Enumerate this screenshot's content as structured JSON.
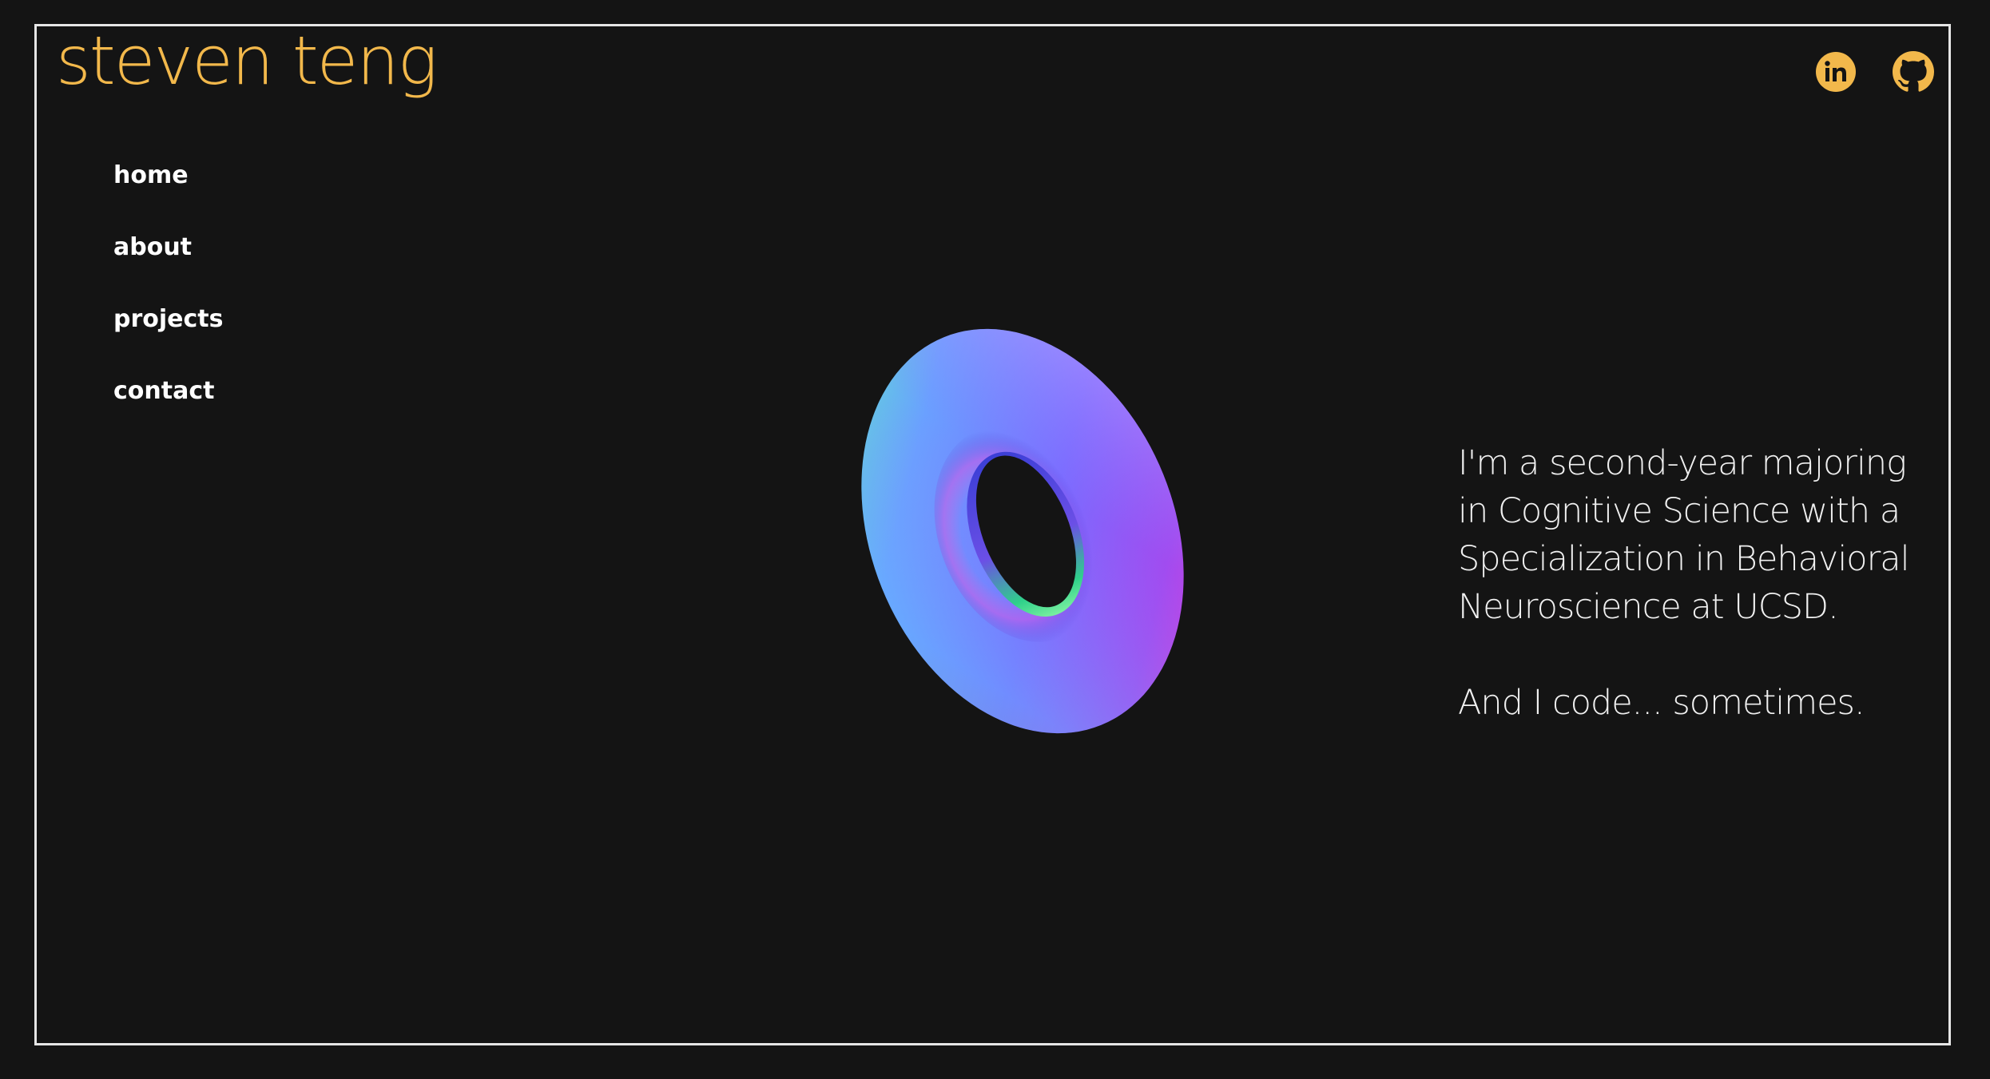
{
  "header": {
    "logo_text": "steven teng",
    "accent_color": "#f2b84b",
    "social": [
      {
        "name": "linkedin",
        "icon": "linkedin-icon"
      },
      {
        "name": "github",
        "icon": "github-icon"
      }
    ]
  },
  "nav": {
    "items": [
      {
        "label": "home"
      },
      {
        "label": "about"
      },
      {
        "label": "projects"
      },
      {
        "label": "contact"
      }
    ]
  },
  "hero": {
    "graphic": "rainbow-torus",
    "intro_line1": "I'm a second-year majoring in Cognitive Science with a Specialization in Behavioral Neuroscience at UCSD.",
    "intro_line2": "And I code... sometimes."
  },
  "theme": {
    "background": "#141414",
    "frame_border": "#e6e6e6",
    "text": "#f0f0f0"
  }
}
